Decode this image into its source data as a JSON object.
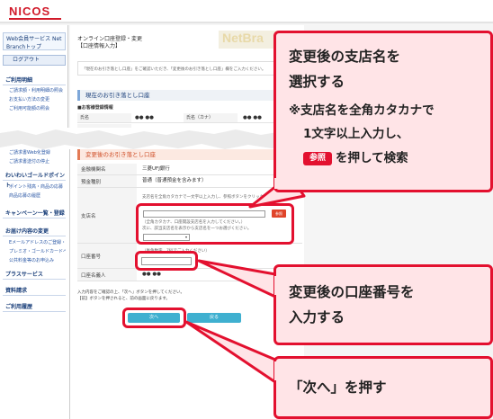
{
  "header": {
    "logo_text": "NICOS"
  },
  "sidebar": {
    "service_logo": "Web会員サービス Net Branchトップ",
    "logout": "ログアウト",
    "sections": [
      {
        "title": "ご利用明細",
        "items": [
          "ご請求額・利用明細の照会",
          "お支払い方法の変更",
          "ご利用可能額の照会"
        ]
      },
      {
        "title": "",
        "items": [
          "ご請求書Web化登録",
          "ご請求書送付の停止"
        ]
      },
      {
        "title": "わいわいゴールドポイント",
        "items": [
          "ポイント残高・商品の応募",
          "商品応募の履歴"
        ]
      },
      {
        "title": "キャンペーン一覧・登録",
        "items": []
      },
      {
        "title": "お届け内容の変更",
        "items": [
          "Eメールアドレスのご登録・変更",
          "プレミオ・ゴールドカードへの切替",
          "公共料金等のお申込み"
        ]
      },
      {
        "title": "プラスサービス",
        "items": []
      },
      {
        "title": "資料請求",
        "items": []
      },
      {
        "title": "ご利用履歴",
        "items": []
      }
    ]
  },
  "main": {
    "title": "オンライン口座登録・変更",
    "subtitle": "【口座情報入力】",
    "banner": "NetBra",
    "notice": "「現在のお引き落とし口座」をご確認いただき、「変更後のお引き落とし口座」欄をご入力ください。",
    "current_section": "現在のお引き落とし口座",
    "current_sub": "■お客様登録情報",
    "current_rows": [
      {
        "label": "氏名",
        "value": "●● ●●",
        "label2": "氏名（カナ）",
        "value2": "●● ●●"
      }
    ],
    "new_section": "変更後のお引き落とし口座",
    "rows": {
      "bank_label": "金融機関名",
      "bank_value": "三菱UFJ銀行",
      "deposit_label": "預金種別",
      "deposit_value": "普通（普通預金を含みます）",
      "branch_label": "支店名",
      "branch_hint1": "支店名を全角カタカナで一文字以上入力し、参照ボタンをクリックし",
      "branch_ref": "参照",
      "branch_hint2": "（全角カタカナ、口座開設支店名を入力してください。）",
      "branch_hint3": "次に、該当支店名を表示から支店名を一つお選びください。",
      "account_label": "口座番号",
      "account_hint": "（半角数字、7桁でご入力ください）",
      "holder_label": "口座名義人",
      "holder_value": "●● ●●"
    },
    "foot1": "入力内容をご確認の上、「次へ」ボタンを押してください。",
    "foot2": "【前】ボタンを押されると、前の画面に戻ります。",
    "next_btn": "次へ",
    "back_btn": "戻る"
  },
  "callouts": {
    "c1_line1": "変更後の支店名を",
    "c1_line2": "選択する",
    "c1_note1": "※支店名を全角カタカナで",
    "c1_note2": "1文字以上入力し、",
    "c1_btn": "参照",
    "c1_note3": "を押して検索",
    "c2_line1": "変更後の口座番号を",
    "c2_line2": "入力する",
    "c3_line1": "「次へ」を押す"
  },
  "colors": {
    "accent": "#e3102f",
    "callout_bg": "#ffe4e7",
    "button": "#3fb0d0"
  }
}
